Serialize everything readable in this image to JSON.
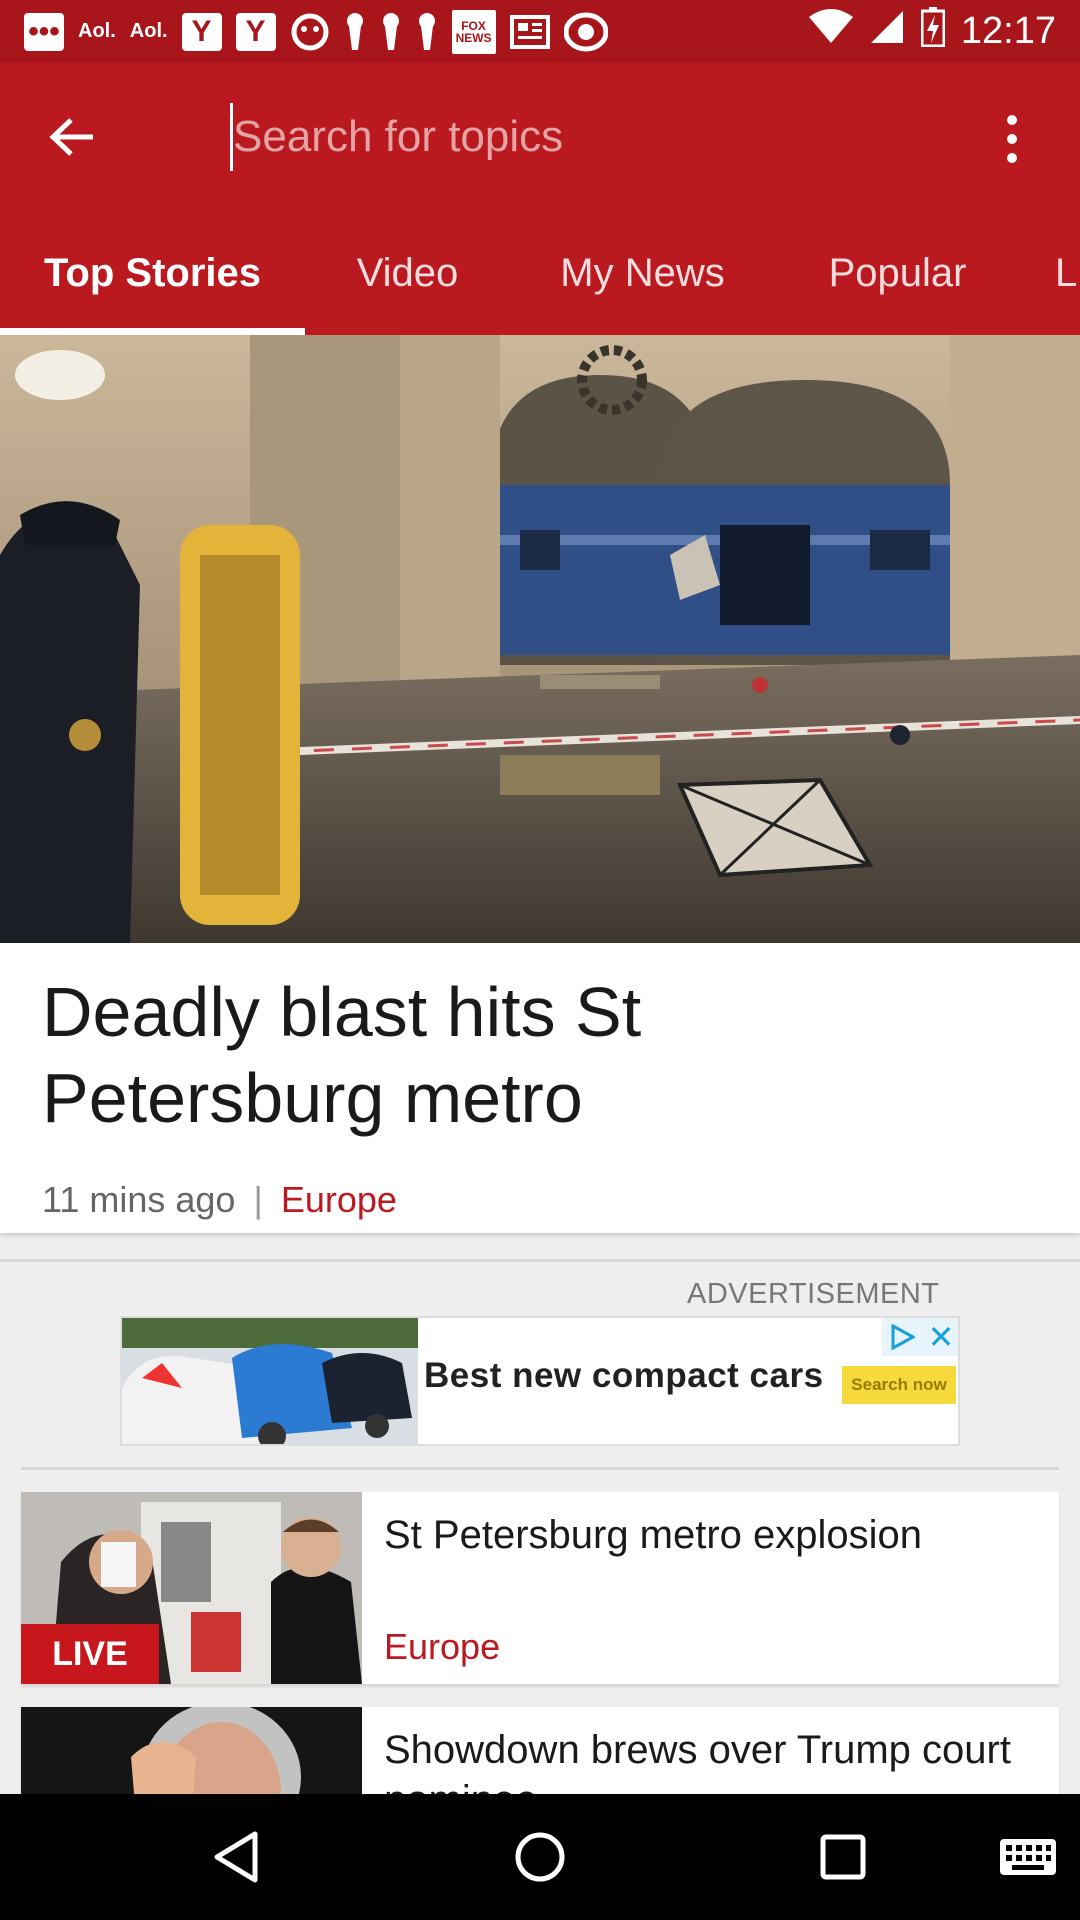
{
  "status_bar": {
    "icons": [
      "messages-icon",
      "aol-icon",
      "aol-icon",
      "yahoo-icon",
      "yahoo-icon",
      "game-icon",
      "pin-icon",
      "pin-icon",
      "pin-icon",
      "fox-news-icon",
      "news-icon",
      "cbs-icon"
    ],
    "aol_label": "Aol.",
    "yahoo_label": "Y",
    "fox_label": "FOX NEWS",
    "time": "12:17"
  },
  "toolbar": {
    "search_placeholder": "Search for topics"
  },
  "tabs": [
    {
      "label": "Top Stories",
      "active": true
    },
    {
      "label": "Video"
    },
    {
      "label": "My News"
    },
    {
      "label": "Popular"
    },
    {
      "label": "L"
    }
  ],
  "hero": {
    "title": "Deadly blast hits St Petersburg metro",
    "time": "11 mins ago",
    "separator": "|",
    "section": "Europe"
  },
  "ad": {
    "label": "ADVERTISEMENT",
    "text": "Best new compact cars",
    "cta": "Search now"
  },
  "stories": [
    {
      "title": "St Petersburg metro explosion",
      "section": "Europe",
      "badge": "LIVE"
    },
    {
      "title": "Showdown brews over Trump court nominee",
      "section": ""
    }
  ],
  "colors": {
    "brand": "#bb1920",
    "status_bar": "#a8151b",
    "section_text": "#bb1920"
  }
}
